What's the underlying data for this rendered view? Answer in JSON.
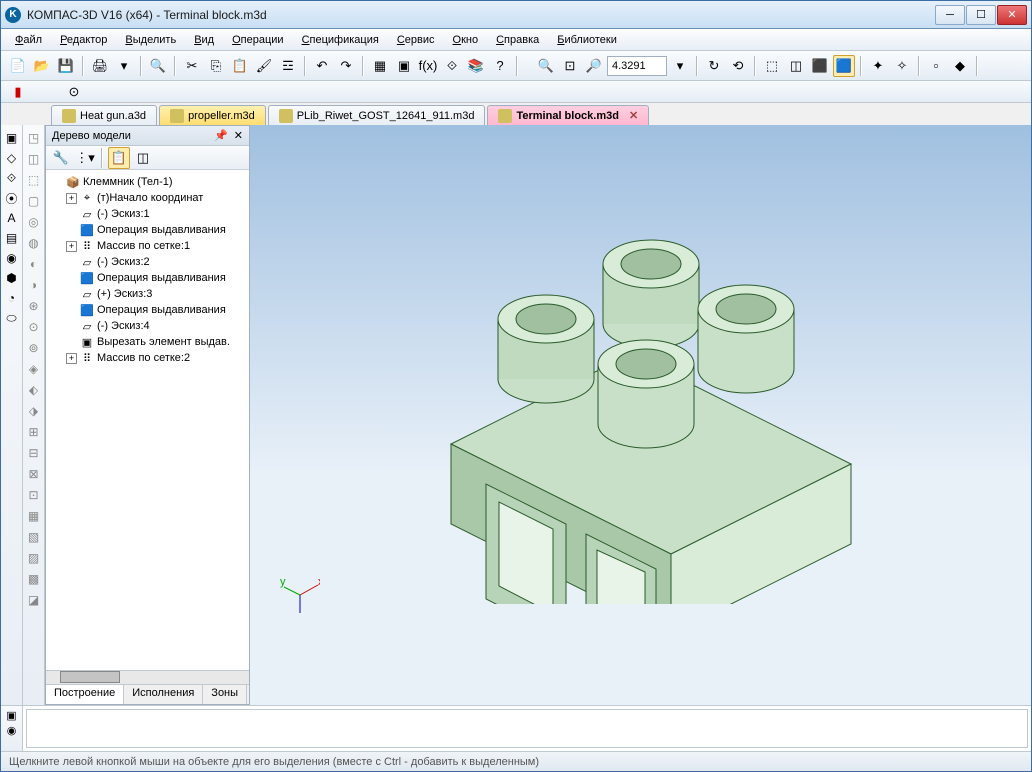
{
  "title": "КОМПАС-3D V16  (x64) - Terminal block.m3d",
  "menu": [
    "Файл",
    "Редактор",
    "Выделить",
    "Вид",
    "Операции",
    "Спецификация",
    "Сервис",
    "Окно",
    "Справка",
    "Библиотеки"
  ],
  "zoom_value": "4.3291",
  "tabs": [
    {
      "label": "Heat gun.a3d",
      "cls": ""
    },
    {
      "label": "propeller.m3d",
      "cls": "yellow"
    },
    {
      "label": "PLib_Riwet_GOST_12641_911.m3d",
      "cls": ""
    },
    {
      "label": "Terminal block.m3d",
      "cls": "pink",
      "close": true
    }
  ],
  "panel_title": "Дерево модели",
  "tree": [
    {
      "exp": "",
      "ic": "📦",
      "txt": "Клеммник (Тел-1)",
      "pad": 0,
      "bold": false
    },
    {
      "exp": "+",
      "ic": "⌖",
      "txt": "(т)Начало координат",
      "pad": 14
    },
    {
      "exp": "",
      "ic": "▱",
      "txt": "(-) Эскиз:1",
      "pad": 14
    },
    {
      "exp": "",
      "ic": "🟦",
      "txt": "Операция выдавливания",
      "pad": 14
    },
    {
      "exp": "+",
      "ic": "⠿",
      "txt": "Массив по сетке:1",
      "pad": 14
    },
    {
      "exp": "",
      "ic": "▱",
      "txt": "(-) Эскиз:2",
      "pad": 14
    },
    {
      "exp": "",
      "ic": "🟦",
      "txt": "Операция выдавливания",
      "pad": 14
    },
    {
      "exp": "",
      "ic": "▱",
      "txt": "(+) Эскиз:3",
      "pad": 14
    },
    {
      "exp": "",
      "ic": "🟦",
      "txt": "Операция выдавливания",
      "pad": 14
    },
    {
      "exp": "",
      "ic": "▱",
      "txt": "(-) Эскиз:4",
      "pad": 14
    },
    {
      "exp": "",
      "ic": "▣",
      "txt": "Вырезать элемент выдав.",
      "pad": 14
    },
    {
      "exp": "+",
      "ic": "⠿",
      "txt": "Массив по сетке:2",
      "pad": 14
    }
  ],
  "panel_tabs": [
    "Построение",
    "Исполнения",
    "Зоны"
  ],
  "status": "Щелкните левой кнопкой мыши на объекте для его выделения (вместе с Ctrl - добавить к выделенным)"
}
